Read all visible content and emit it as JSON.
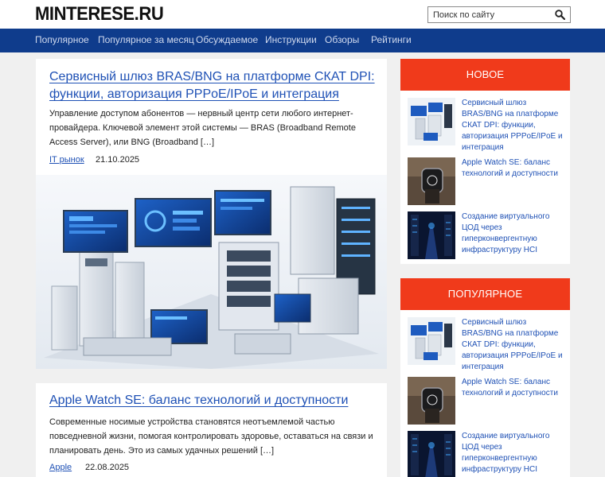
{
  "site": {
    "logo": "MINTERESE.RU"
  },
  "search": {
    "placeholder": "Поиск по сайту"
  },
  "nav": [
    "Популярное",
    "Популярное за месяц",
    "Обсуждаемое",
    "Инструкции",
    "Обзоры",
    "Рейтинги"
  ],
  "posts": [
    {
      "title": "Сервисный шлюз BRAS/BNG на платформе СКАТ DPI: функции, авторизация PPPoE/IPoE и интеграция",
      "excerpt": "Управление доступом абонентов — нервный центр сети любого интернет-провайдера. Ключевой элемент этой системы — BRAS (Broadband Remote Access Server), или BNG (Broadband […]",
      "category": "IT рынок",
      "date": "21.10.2025"
    },
    {
      "title": "Apple Watch SE: баланс технологий и доступности",
      "excerpt": "Современные носимые устройства становятся неотъемлемой частью повседневной жизни, помогая контролировать здоровье, оставаться на связи и планировать день. Это из самых удачных решений […]",
      "category": "Apple",
      "date": "22.08.2025"
    }
  ],
  "sidebar": {
    "new": {
      "heading": "НОВОЕ",
      "items": [
        {
          "title": "Сервисный шлюз BRAS/BNG на платформе СКАТ DPI: функции, авторизация PPPoE/IPoE и интеграция",
          "thumb": "servers"
        },
        {
          "title": "Apple Watch SE: баланс технологий и доступности",
          "thumb": "watch"
        },
        {
          "title": "Создание виртуального ЦОД через гиперконвергентную инфраструктуру HCI",
          "thumb": "datacenter"
        }
      ]
    },
    "popular": {
      "heading": "ПОПУЛЯРНОЕ",
      "items": [
        {
          "title": "Сервисный шлюз BRAS/BNG на платформе СКАТ DPI: функции, авторизация PPPoE/IPoE и интеграция",
          "thumb": "servers"
        },
        {
          "title": "Apple Watch SE: баланс технологий и доступности",
          "thumb": "watch"
        },
        {
          "title": "Создание виртуального ЦОД через гиперконвергентную инфраструктуру HCI",
          "thumb": "datacenter"
        }
      ]
    }
  },
  "colors": {
    "nav_bg": "#0f3c8c",
    "widget_head": "#f03a1b",
    "link": "#1f51b5",
    "page_bg": "#f0f0f0"
  }
}
